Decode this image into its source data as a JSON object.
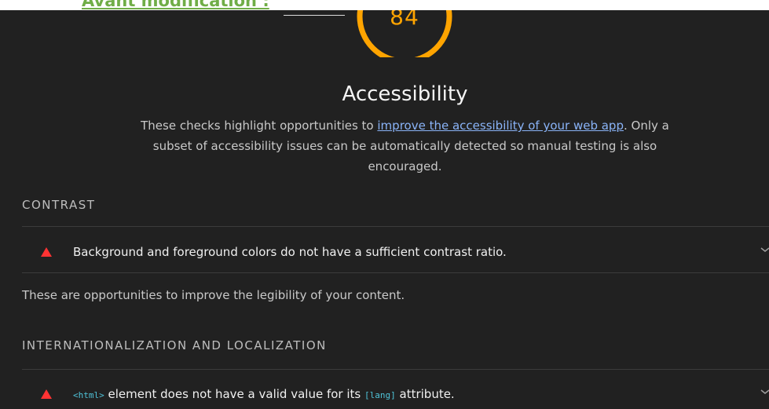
{
  "caption": "Avant modification :",
  "gauge": {
    "score": "84",
    "fraction": 0.84,
    "color": "#ffa400"
  },
  "category": {
    "title": "Accessibility",
    "description_before": "These checks highlight opportunities to ",
    "description_link": "improve the accessibility of your web app",
    "description_after": ". Only a subset of accessibility issues can be automatically detected so manual testing is also encouraged."
  },
  "groups": [
    {
      "header": "CONTRAST",
      "audit": {
        "icon": "warning-triangle-icon",
        "text": "Background and foreground colors do not have a sufficient contrast ratio."
      },
      "description": "These are opportunities to improve the legibility of your content."
    },
    {
      "header": "INTERNATIONALIZATION AND LOCALIZATION",
      "audit": {
        "icon": "warning-triangle-icon",
        "code_1": "<html>",
        "text_1": " element does not have a valid value for its ",
        "code_2": "[lang]",
        "text_2": " attribute."
      }
    }
  ],
  "colors": {
    "background": "#212121",
    "fail": "#ff3333",
    "link": "#8ab4f8",
    "code": "#4fc3d8"
  }
}
